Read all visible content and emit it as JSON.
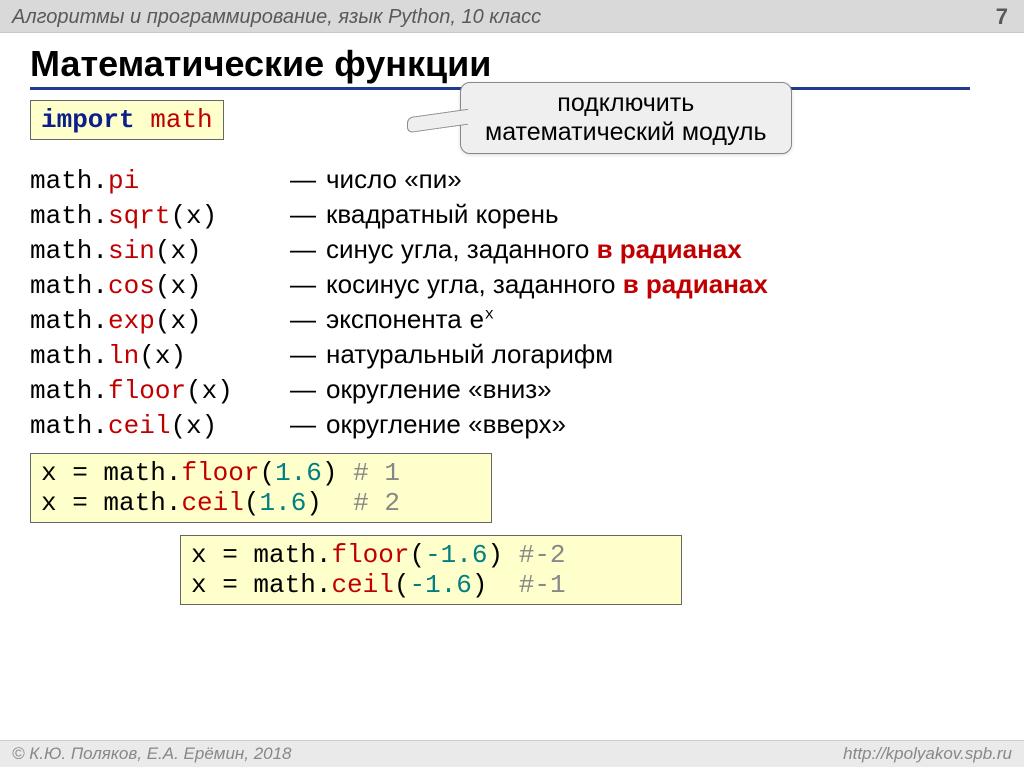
{
  "header": {
    "course": "Алгоритмы и программирование, язык Python, 10 класс",
    "page": "7"
  },
  "title": "Математические функции",
  "importLine": {
    "kw": "import",
    "mod": "math"
  },
  "callout": {
    "line1": "подключить",
    "line2": "математический модуль"
  },
  "funcs": [
    {
      "mod": "math",
      "dot": ".",
      "name": "pi",
      "arg": "",
      "desc": "число «пи»",
      "extra": ""
    },
    {
      "mod": "math",
      "dot": ".",
      "name": "sqrt",
      "arg": "(x)",
      "desc": "квадратный корень",
      "extra": ""
    },
    {
      "mod": "math",
      "dot": ".",
      "name": "sin",
      "arg": "(x)",
      "desc": "синус угла, заданного ",
      "extra": "в радианах"
    },
    {
      "mod": "math",
      "dot": ".",
      "name": "cos",
      "arg": "(x)",
      "desc": "косинус угла, заданного ",
      "extra": "в радианах"
    },
    {
      "mod": "math",
      "dot": ".",
      "name": "exp",
      "arg": "(x)",
      "desc": "экспонента ",
      "extra": "",
      "tail_mono": "e",
      "tail_sup": "x"
    },
    {
      "mod": "math",
      "dot": ".",
      "name": "ln",
      "arg": "(x)",
      "desc": "натуральный логарифм",
      "extra": ""
    },
    {
      "mod": "math",
      "dot": ".",
      "name": "floor",
      "arg": "(x)",
      "desc": "округление «вниз»",
      "extra": ""
    },
    {
      "mod": "math",
      "dot": ".",
      "name": "ceil",
      "arg": "(x)",
      "desc": "округление «вверх»",
      "extra": ""
    }
  ],
  "dash": "—",
  "ex1": [
    {
      "lhs": "x",
      "eq": " = ",
      "mod": "math",
      "dot": ".",
      "name": "floor",
      "open": "(",
      "num": "1.6",
      "close": ")",
      "pad": " ",
      "comment": "# 1"
    },
    {
      "lhs": "x",
      "eq": " = ",
      "mod": "math",
      "dot": ".",
      "name": "ceil",
      "open": "(",
      "num": "1.6",
      "close": ")",
      "pad": "  ",
      "comment": "# 2"
    }
  ],
  "ex2": [
    {
      "lhs": "x",
      "eq": " = ",
      "mod": "math",
      "dot": ".",
      "name": "floor",
      "open": "(",
      "num": "-1.6",
      "close": ")",
      "pad": " ",
      "comment": "#-2"
    },
    {
      "lhs": "x",
      "eq": " = ",
      "mod": "math",
      "dot": ".",
      "name": "ceil",
      "open": "(",
      "num": "-1.6",
      "close": ")",
      "pad": "  ",
      "comment": "#-1"
    }
  ],
  "footer": {
    "left": "© К.Ю. Поляков, Е.А. Ерёмин, 2018",
    "right": "http://kpolyakov.spb.ru"
  }
}
